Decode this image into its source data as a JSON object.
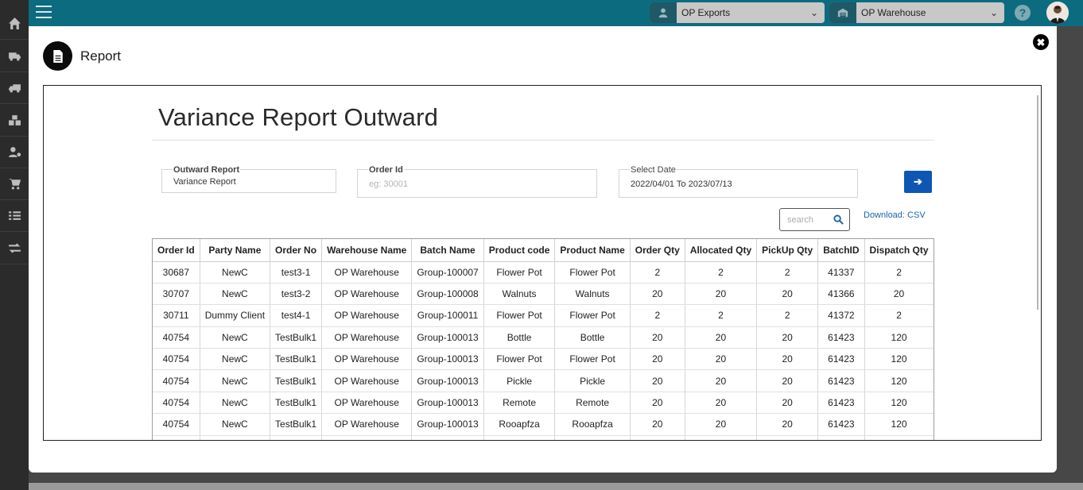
{
  "app": {
    "company_select": "OP Exports",
    "warehouse_select": "OP Warehouse",
    "help_label": "?"
  },
  "sidebar": {
    "items": [
      {
        "icon": "home-icon"
      },
      {
        "icon": "truck-icon"
      },
      {
        "icon": "delivery-truck-icon"
      },
      {
        "icon": "boxes-icon"
      },
      {
        "icon": "user-settings-icon"
      },
      {
        "icon": "cart-icon"
      },
      {
        "icon": "checklist-icon"
      },
      {
        "icon": "transfer-icon"
      }
    ]
  },
  "modal": {
    "title": "Report",
    "close_label": "✖",
    "report_title": "Variance Report Outward",
    "filters": {
      "outward_report_label": "Outward Report",
      "outward_report_value": "Variance Report",
      "order_id_label": "Order Id",
      "order_id_placeholder": "eg: 30001",
      "date_label": "Select Date",
      "date_value": "2022/04/01 To 2023/07/13",
      "go_label": "➔"
    },
    "search_placeholder": "search",
    "download_label": "Download: CSV",
    "table": {
      "columns": [
        "Order Id",
        "Party Name",
        "Order No",
        "Warehouse Name",
        "Batch Name",
        "Product code",
        "Product Name",
        "Order Qty",
        "Allocated Qty",
        "PickUp Qty",
        "BatchID",
        "Dispatch Qty"
      ],
      "rows": [
        [
          "30687",
          "NewC",
          "test3-1",
          "OP Warehouse",
          "Group-100007",
          "Flower Pot",
          "Flower Pot",
          "2",
          "2",
          "2",
          "41337",
          "2"
        ],
        [
          "30707",
          "NewC",
          "test3-2",
          "OP Warehouse",
          "Group-100008",
          "Walnuts",
          "Walnuts",
          "20",
          "20",
          "20",
          "41366",
          "20"
        ],
        [
          "30711",
          "Dummy Client",
          "test4-1",
          "OP Warehouse",
          "Group-100011",
          "Flower Pot",
          "Flower Pot",
          "2",
          "2",
          "2",
          "41372",
          "2"
        ],
        [
          "40754",
          "NewC",
          "TestBulk1",
          "OP Warehouse",
          "Group-100013",
          "Bottle",
          "Bottle",
          "20",
          "20",
          "20",
          "61423",
          "120"
        ],
        [
          "40754",
          "NewC",
          "TestBulk1",
          "OP Warehouse",
          "Group-100013",
          "Flower Pot",
          "Flower Pot",
          "20",
          "20",
          "20",
          "61423",
          "120"
        ],
        [
          "40754",
          "NewC",
          "TestBulk1",
          "OP Warehouse",
          "Group-100013",
          "Pickle",
          "Pickle",
          "20",
          "20",
          "20",
          "61423",
          "120"
        ],
        [
          "40754",
          "NewC",
          "TestBulk1",
          "OP Warehouse",
          "Group-100013",
          "Remote",
          "Remote",
          "20",
          "20",
          "20",
          "61423",
          "120"
        ],
        [
          "40754",
          "NewC",
          "TestBulk1",
          "OP Warehouse",
          "Group-100013",
          "Rooapfza",
          "Rooapfza",
          "20",
          "20",
          "20",
          "61423",
          "120"
        ]
      ]
    }
  },
  "colors": {
    "topbar": "#0d6b80",
    "sidebar": "#2b2b2b",
    "primary_button": "#0d56b3",
    "link": "#1864ab"
  }
}
